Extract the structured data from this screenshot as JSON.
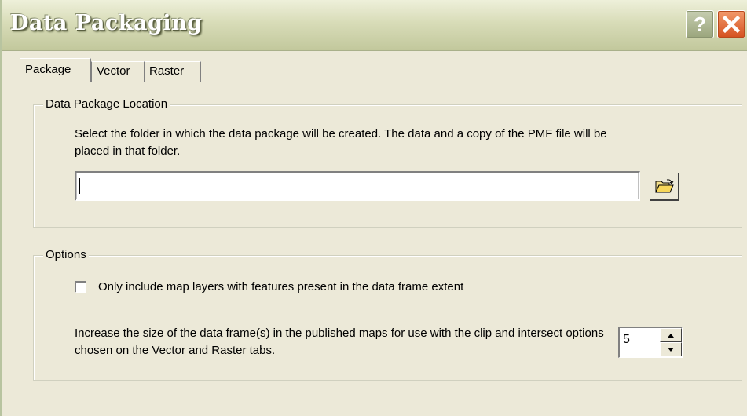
{
  "window": {
    "title": "Data Packaging",
    "help_label": "?"
  },
  "tabs": [
    {
      "label": "Package",
      "active": true
    },
    {
      "label": "Vector",
      "active": false
    },
    {
      "label": "Raster",
      "active": false
    }
  ],
  "location": {
    "legend": "Data Package Location",
    "description": "Select the folder in which the data package will be created. The data and a copy of the PMF file will be placed in that folder.",
    "path_value": "",
    "browse_icon": "folder-open-icon"
  },
  "options": {
    "legend": "Options",
    "only_include_label": "Only include map layers with features present in the data frame extent",
    "only_include_checked": false,
    "expand_label": "Increase the size of the data frame(s) in the published maps for use with the clip and intersect options chosen on the Vector and Raster tabs.",
    "expand_value": "5"
  },
  "colors": {
    "dialog_bg": "#ece9d8",
    "close_button": "#d4501f"
  }
}
